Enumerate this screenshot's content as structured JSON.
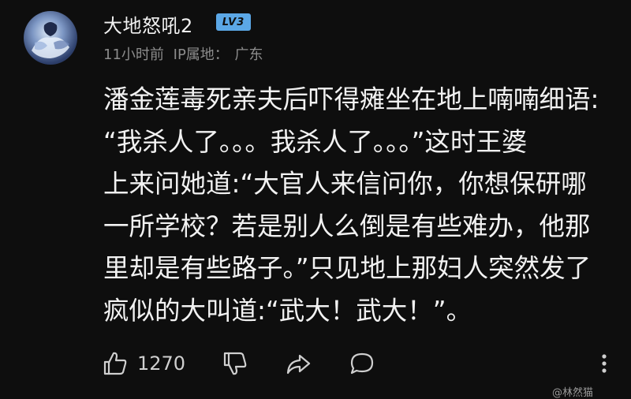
{
  "user": {
    "name": "大地怒吼2",
    "level_badge": "LV3"
  },
  "meta": {
    "time": "11小时前",
    "ip_label": "IP属地：",
    "location": "广东"
  },
  "comment": {
    "lines": [
      "潘金莲毒死亲夫后吓得瘫坐在地上喃喃细语:",
      "“我杀人了。。。我杀人了。。。”这时王婆",
      "上来问她道:“大官人来信问你，你想保研哪",
      "一所学校？若是别人么倒是有些难办，他那",
      "里却是有些路子。”只见地上那妇人突然发了",
      "疯似的大叫道:“武大！武大！”。"
    ]
  },
  "actions": {
    "like_count": "1270",
    "like_icon": "thumbs-up-icon",
    "dislike_icon": "thumbs-down-icon",
    "share_icon": "share-arrow-icon",
    "reply_icon": "comment-bubble-icon",
    "more_icon": "more-vertical-icon"
  },
  "watermark": {
    "text": "@林然猫"
  },
  "colors": {
    "background": "#0e0e0e",
    "badge": "#5ba7e6",
    "text": "#f2f2f2",
    "muted": "#8c8c8c"
  }
}
